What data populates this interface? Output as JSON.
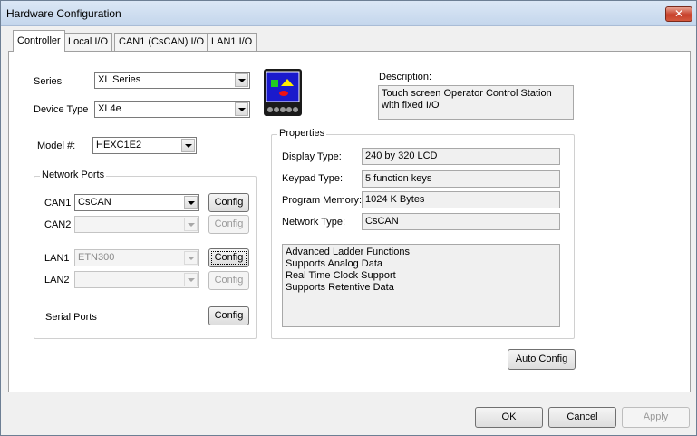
{
  "window": {
    "title": "Hardware Configuration",
    "close_label": "✕"
  },
  "tabs": [
    {
      "label": "Controller",
      "active": true
    },
    {
      "label": "Local I/O"
    },
    {
      "label": "CAN1 (CsCAN) I/O"
    },
    {
      "label": "LAN1 I/O"
    }
  ],
  "controller": {
    "series_label": "Series",
    "series_value": "XL Series",
    "device_type_label": "Device Type",
    "device_type_value": "XL4e",
    "model_label": "Model #:",
    "model_value": "HEXC1E2",
    "description_label": "Description:",
    "description_value": "Touch screen Operator Control Station with fixed I/O"
  },
  "network_ports": {
    "title": "Network Ports",
    "can1_label": "CAN1",
    "can1_value": "CsCAN",
    "can2_label": "CAN2",
    "can2_value": "",
    "lan1_label": "LAN1",
    "lan1_value": "ETN300",
    "lan2_label": "LAN2",
    "lan2_value": "",
    "serial_label": "Serial Ports",
    "config_label": "Config"
  },
  "properties": {
    "title": "Properties",
    "display_type_label": "Display Type:",
    "display_type_value": "240 by 320 LCD",
    "keypad_type_label": "Keypad Type:",
    "keypad_type_value": "5 function keys",
    "program_memory_label": "Program Memory:",
    "program_memory_value": "1024 K Bytes",
    "network_type_label": "Network Type:",
    "network_type_value": "CsCAN",
    "features": [
      "Advanced Ladder Functions",
      "Supports Analog Data",
      "Real Time Clock Support",
      "Supports Retentive Data"
    ]
  },
  "buttons": {
    "auto_config": "Auto Config",
    "ok": "OK",
    "cancel": "Cancel",
    "apply": "Apply"
  },
  "colors": {
    "icon_screen": "#1a1acc",
    "icon_square": "#22cc22",
    "icon_triangle": "#ffee00",
    "icon_ellipse": "#ee1111"
  }
}
